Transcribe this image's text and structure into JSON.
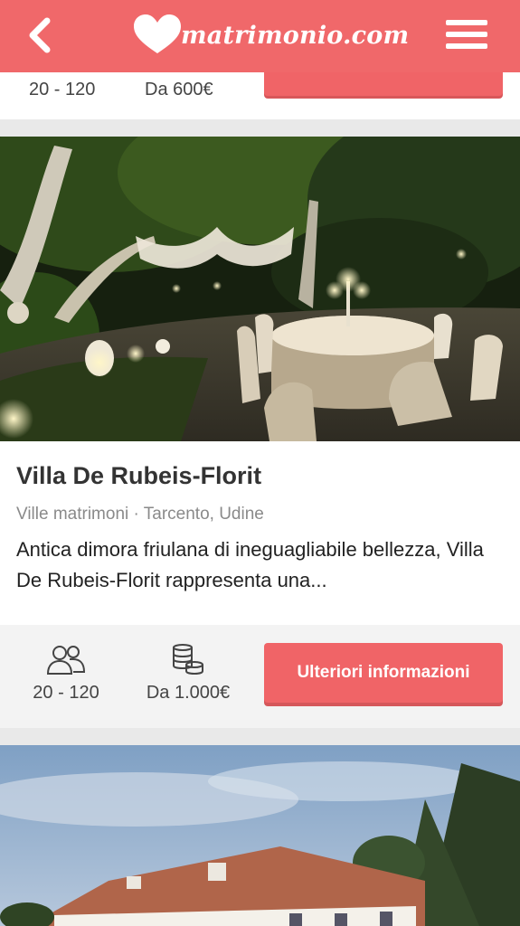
{
  "header": {
    "logo_text": "matrimonio.com",
    "back_icon": "chevron-left-icon",
    "menu_icon": "hamburger-menu-icon"
  },
  "previous_card": {
    "capacity": "20 - 120",
    "price": "Da 600€"
  },
  "venue": {
    "title": "Villa De Rubeis-Florit",
    "subtitle": "Ville matrimoni · Tarcento, Udine",
    "description": "Antica dimora friulana di ineguagliabile bellezza, Villa De Rubeis-Florit rappresenta una...",
    "capacity": "20 - 120",
    "price": "Da 1.000€",
    "cta_label": "Ulteriori informazioni",
    "capacity_icon": "guests-icon",
    "price_icon": "coins-icon"
  },
  "colors": {
    "brand": "#f0686a",
    "button": "#f06467",
    "text_dark": "#333333",
    "text_muted": "#8a8a8a"
  }
}
